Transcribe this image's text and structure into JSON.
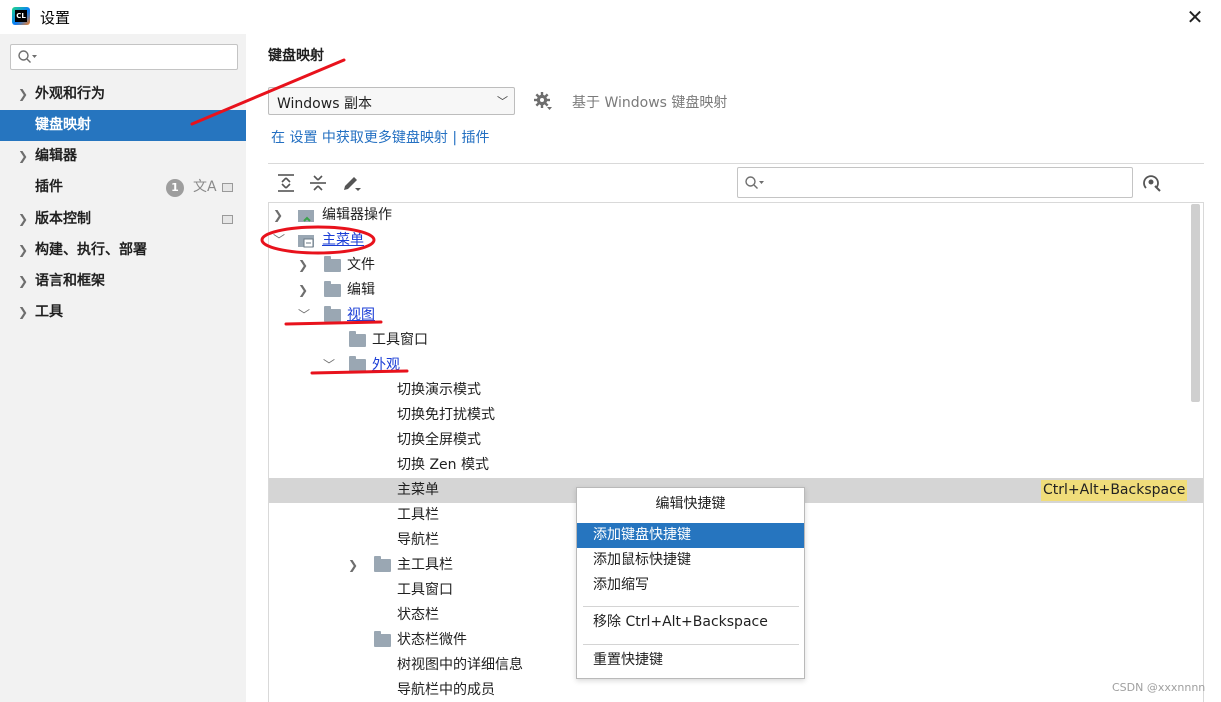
{
  "window": {
    "app_icon_text": "CL",
    "title": "设置",
    "close_glyph": "✕"
  },
  "sidebar": {
    "search_placeholder": "",
    "items": [
      {
        "label": "外观和行为",
        "expandable": true
      },
      {
        "label": "键盘映射",
        "expandable": false,
        "selected": true
      },
      {
        "label": "编辑器",
        "expandable": true
      },
      {
        "label": "插件",
        "expandable": false,
        "badge": "1"
      },
      {
        "label": "版本控制",
        "expandable": true
      },
      {
        "label": "构建、执行、部署",
        "expandable": true
      },
      {
        "label": "语言和框架",
        "expandable": true
      },
      {
        "label": "工具",
        "expandable": true
      }
    ]
  },
  "main": {
    "title": "键盘映射",
    "keymap_select_value": "Windows 副本",
    "based_on": "基于 Windows 键盘映射",
    "get_more_link": "在 设置 中获取更多键盘映射 | 插件",
    "search_placeholder": ""
  },
  "tree": {
    "rows": [
      {
        "label": "编辑器操作",
        "depth": 0,
        "chevron": "right",
        "icon": "editor-actions-icon"
      },
      {
        "label": "主菜单",
        "depth": 0,
        "chevron": "down",
        "icon": "main-menu-icon",
        "link": true
      },
      {
        "label": "文件",
        "depth": 1,
        "chevron": "right",
        "icon": "folder-icon"
      },
      {
        "label": "编辑",
        "depth": 1,
        "chevron": "right",
        "icon": "folder-icon"
      },
      {
        "label": "视图",
        "depth": 1,
        "chevron": "down",
        "icon": "folder-icon",
        "link": true
      },
      {
        "label": "工具窗口",
        "depth": 2,
        "chevron": "",
        "icon": "folder-icon"
      },
      {
        "label": "外观",
        "depth": 2,
        "chevron": "down",
        "icon": "folder-icon",
        "link": true
      },
      {
        "label": "切换演示模式",
        "depth": 3,
        "chevron": "",
        "icon": ""
      },
      {
        "label": "切换免打扰模式",
        "depth": 3,
        "chevron": "",
        "icon": ""
      },
      {
        "label": "切换全屏模式",
        "depth": 3,
        "chevron": "",
        "icon": ""
      },
      {
        "label": "切换 Zen 模式",
        "depth": 3,
        "chevron": "",
        "icon": ""
      },
      {
        "label": "主菜单",
        "depth": 3,
        "chevron": "",
        "icon": "",
        "selected": true,
        "shortcut": "Ctrl+Alt+Backspace"
      },
      {
        "label": "工具栏",
        "depth": 3,
        "chevron": "",
        "icon": ""
      },
      {
        "label": "导航栏",
        "depth": 3,
        "chevron": "",
        "icon": ""
      },
      {
        "label": "主工具栏",
        "depth": 2,
        "chevron": "right",
        "icon": "folder-icon"
      },
      {
        "label": "工具窗口",
        "depth": 3,
        "chevron": "",
        "icon": ""
      },
      {
        "label": "状态栏",
        "depth": 3,
        "chevron": "",
        "icon": ""
      },
      {
        "label": "状态栏微件",
        "depth": 2,
        "chevron": "",
        "icon": "folder-icon"
      },
      {
        "label": "树视图中的详细信息",
        "depth": 3,
        "chevron": "",
        "icon": ""
      },
      {
        "label": "导航栏中的成员",
        "depth": 3,
        "chevron": "",
        "icon": ""
      }
    ]
  },
  "context_menu": {
    "header": "编辑快捷键",
    "items": [
      {
        "label": "添加键盘快捷键",
        "selected": true
      },
      {
        "label": "添加鼠标快捷键"
      },
      {
        "label": "添加缩写"
      },
      {
        "label": "移除 Ctrl+Alt+Backspace"
      },
      {
        "label": "重置快捷键"
      }
    ]
  },
  "watermark": "CSDN @xxxnnnn",
  "colors": {
    "accent": "#2675bf",
    "link": "#2470c2",
    "tree_link": "#1a3dd6",
    "shortcut_highlight": "#f0dd7a",
    "annotation_red": "#e8121c"
  }
}
